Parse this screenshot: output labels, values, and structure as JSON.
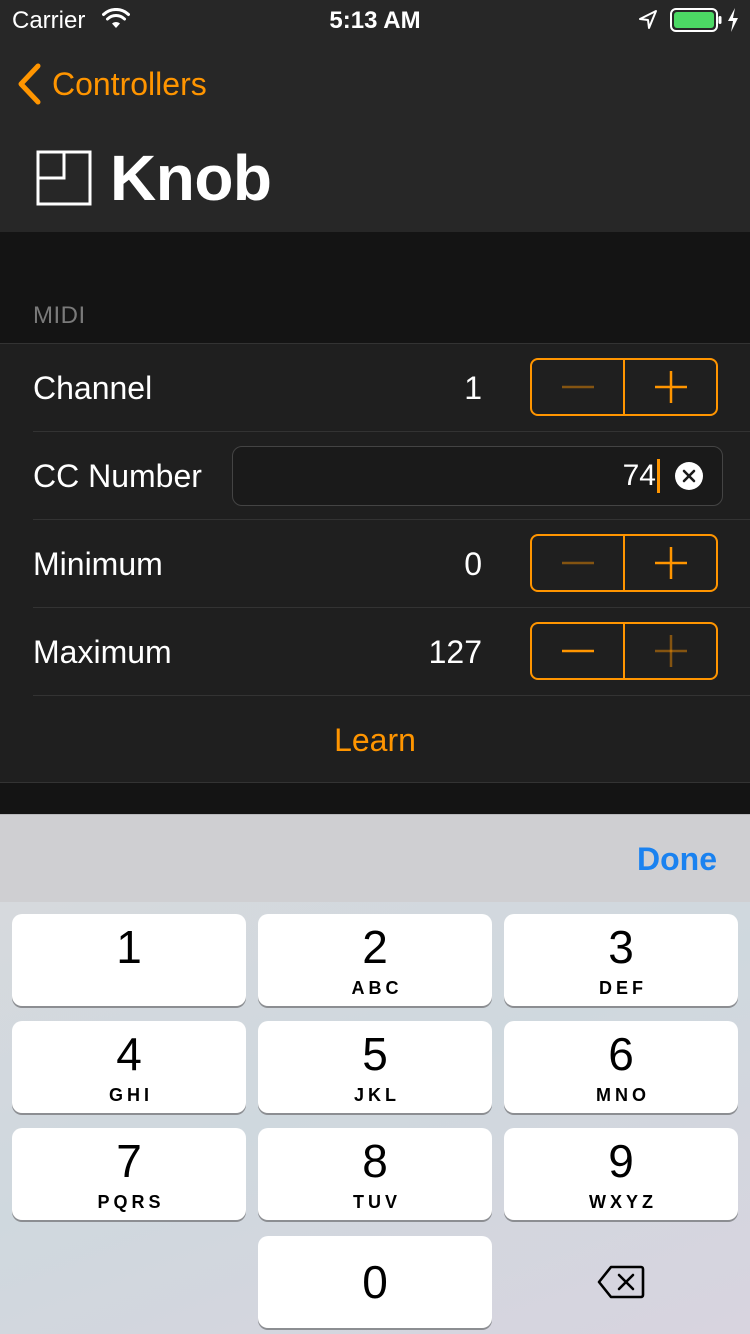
{
  "status_bar": {
    "carrier": "Carrier",
    "time": "5:13 AM",
    "battery_color": "#4cd964"
  },
  "nav": {
    "back_label": "Controllers",
    "title": "Knob",
    "accent_color": "#ff9500"
  },
  "midi": {
    "section_title": "MIDI",
    "channel": {
      "label": "Channel",
      "value": "1"
    },
    "cc_number": {
      "label": "CC Number",
      "value": "74"
    },
    "minimum": {
      "label": "Minimum",
      "value": "0"
    },
    "maximum": {
      "label": "Maximum",
      "value": "127"
    },
    "learn_label": "Learn"
  },
  "keyboard": {
    "done_label": "Done",
    "keys": [
      {
        "digit": "1",
        "letters": ""
      },
      {
        "digit": "2",
        "letters": "ABC"
      },
      {
        "digit": "3",
        "letters": "DEF"
      },
      {
        "digit": "4",
        "letters": "GHI"
      },
      {
        "digit": "5",
        "letters": "JKL"
      },
      {
        "digit": "6",
        "letters": "MNO"
      },
      {
        "digit": "7",
        "letters": "PQRS"
      },
      {
        "digit": "8",
        "letters": "TUV"
      },
      {
        "digit": "9",
        "letters": "WXYZ"
      },
      {
        "digit": "0",
        "letters": ""
      }
    ]
  }
}
